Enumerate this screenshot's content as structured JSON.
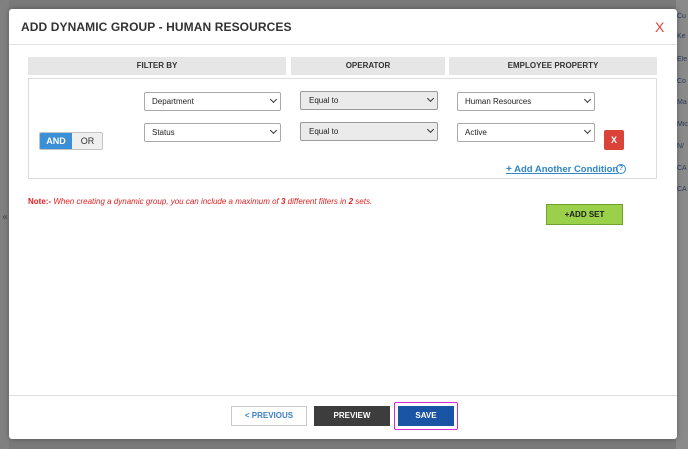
{
  "dialog": {
    "title": "ADD DYNAMIC GROUP - HUMAN RESOURCES",
    "close_label": "X"
  },
  "columns": {
    "filter_by": "FILTER BY",
    "operator": "OPERATOR",
    "employee_property": "EMPLOYEE PROPERTY"
  },
  "rows": [
    {
      "filter": "Department",
      "operator": "Equal to",
      "value": "Human Resources"
    },
    {
      "filter": "Status",
      "operator": "Equal to",
      "value": "Active"
    }
  ],
  "logic": {
    "and_label": "AND",
    "or_label": "OR",
    "selected": "AND"
  },
  "remove_label": "X",
  "add_condition": {
    "plus": "+",
    "label": "Add Another Condition",
    "help": "?"
  },
  "note": {
    "prefix": "Note:-",
    "text1": " When creating a dynamic group, you can include a maximum of ",
    "max_filters": "3",
    "text2": " different filters in ",
    "max_sets": "2",
    "text3": " sets."
  },
  "add_set": {
    "plus": "+",
    "label": "ADD SET"
  },
  "footer": {
    "previous_label": "< PREVIOUS",
    "preview_label": "PREVIEW",
    "save_label": "SAVE"
  },
  "background": {
    "right_items": [
      "Cu",
      "Ke",
      "Ele",
      "Co",
      "Ma",
      "Mic",
      "N/",
      "CA",
      "CA"
    ],
    "left_arrow": "«"
  },
  "colors": {
    "accent": "#3a8fd6",
    "save": "#1a54a5",
    "danger": "#d9433a",
    "add_set": "#9bd04a",
    "highlight": "#d52bd5"
  }
}
